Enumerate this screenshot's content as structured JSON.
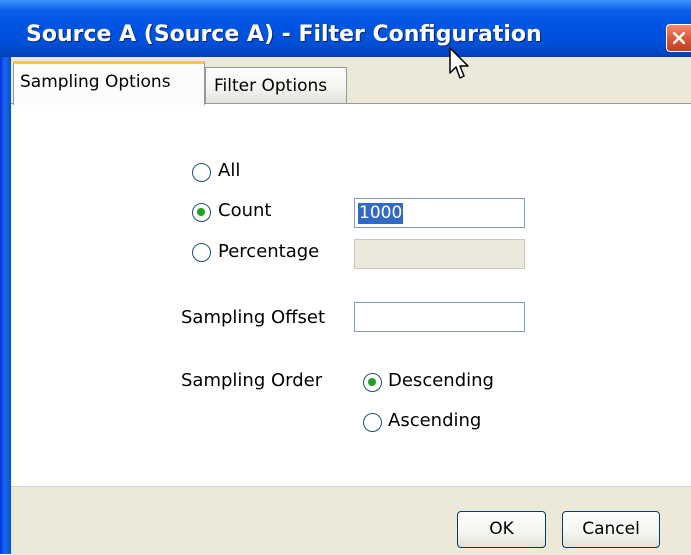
{
  "window": {
    "title": "Source A (Source A) - Filter Configuration"
  },
  "tabs": [
    {
      "label": "Sampling Options",
      "active": true
    },
    {
      "label": "Filter Options",
      "active": false
    }
  ],
  "sampling": {
    "options": [
      {
        "label": "All",
        "selected": false
      },
      {
        "label": "Count",
        "selected": true
      },
      {
        "label": "Percentage",
        "selected": false
      }
    ],
    "count_value": "1000",
    "percentage_value": "",
    "offset_label": "Sampling Offset",
    "offset_value": "",
    "order_label": "Sampling Order",
    "order_options": [
      {
        "label": "Descending",
        "selected": true
      },
      {
        "label": "Ascending",
        "selected": false
      }
    ]
  },
  "buttons": {
    "ok": "OK",
    "cancel": "Cancel"
  },
  "colors": {
    "titlebar": "#0054e3",
    "active_tab_accent": "#ffc83c",
    "radio_dot": "#21a121",
    "selection": "#316ac5"
  }
}
